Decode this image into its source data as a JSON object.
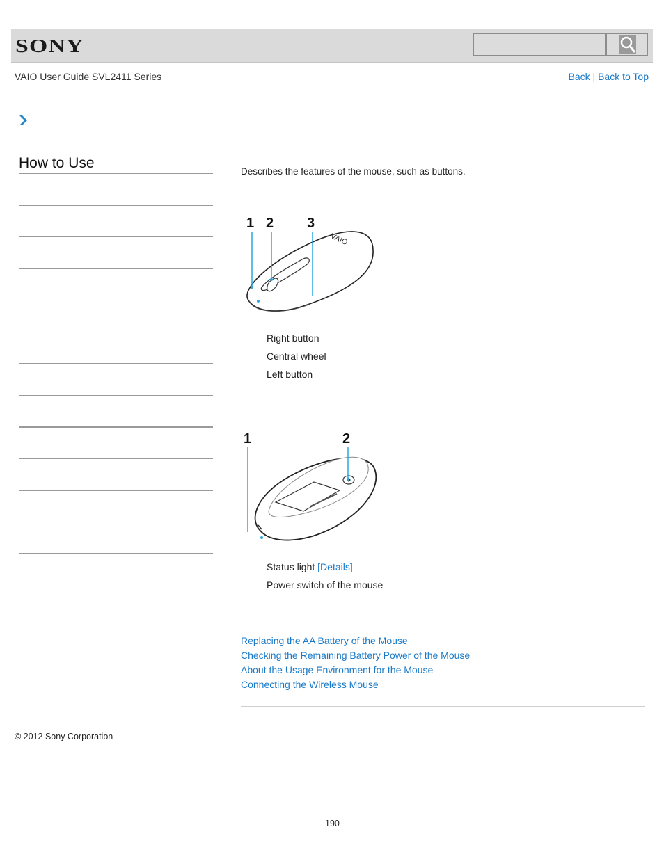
{
  "header": {
    "logo_text": "SONY",
    "search": {
      "placeholder": "",
      "value": ""
    },
    "search_icon": "magnifier-icon"
  },
  "subheader": {
    "guide_title": "VAIO User Guide SVL2411 Series",
    "nav": {
      "back": "Back",
      "separator": "|",
      "back_to_top": "Back to Top"
    }
  },
  "breadcrumb": {
    "icon": "chevron-right-icon"
  },
  "sidebar": {
    "title": "How to Use",
    "item_count": 12
  },
  "main": {
    "intro": "Describes the features of the mouse, such as buttons.",
    "figure_top": {
      "callouts": [
        "1",
        "2",
        "3"
      ],
      "logo_text": "VAIO",
      "items": [
        "Right button",
        "Central wheel",
        "Left button"
      ]
    },
    "figure_bottom": {
      "callouts": [
        "1",
        "2"
      ],
      "items": [
        {
          "text": "Status light",
          "link": "[Details]"
        },
        {
          "text": "Power switch of the mouse"
        }
      ]
    },
    "related_links": [
      "Replacing the AA Battery of the Mouse",
      "Checking the Remaining Battery Power of the Mouse",
      "About the Usage Environment for the Mouse",
      "Connecting the Wireless Mouse"
    ]
  },
  "footer": {
    "copyright": "© 2012 Sony Corporation",
    "page_number": "190"
  },
  "colors": {
    "link": "#1a7ac8",
    "callout": "#29a8e0",
    "header_bg": "#dadada"
  }
}
